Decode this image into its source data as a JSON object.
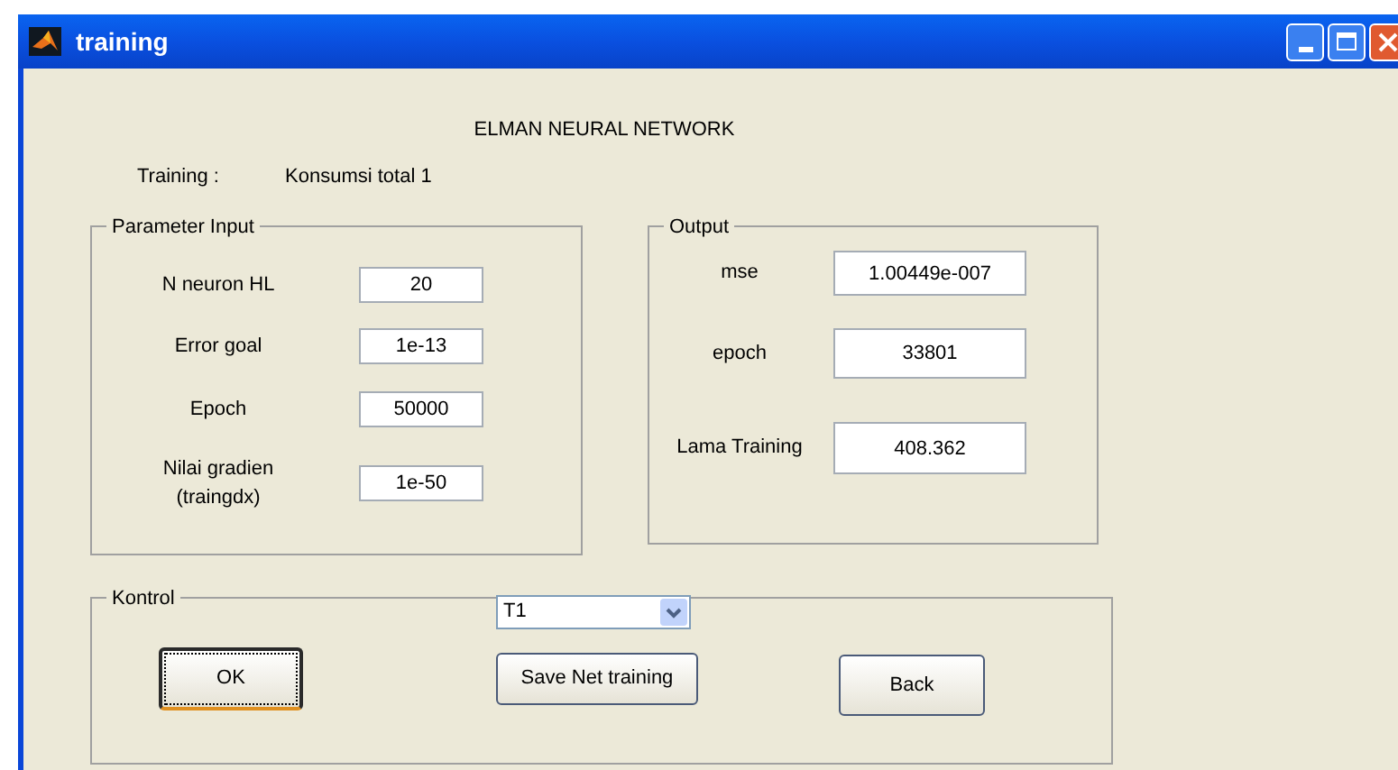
{
  "window": {
    "title": "training"
  },
  "heading": "ELMAN NEURAL NETWORK",
  "training": {
    "label": "Training :",
    "value": "Konsumsi total 1"
  },
  "parameter_input": {
    "title": "Parameter Input",
    "fields": [
      {
        "label": "N neuron HL",
        "value": "20"
      },
      {
        "label": "Error goal",
        "value": "1e-13"
      },
      {
        "label": "Epoch",
        "value": "50000"
      },
      {
        "label": "Nilai gradien\n(traingdx)",
        "value": "1e-50"
      }
    ]
  },
  "output": {
    "title": "Output",
    "fields": [
      {
        "label": "mse",
        "value": "1.00449e-007"
      },
      {
        "label": "epoch",
        "value": "33801"
      },
      {
        "label": "Lama Training",
        "value": "408.362"
      }
    ]
  },
  "kontrol": {
    "title": "Kontrol",
    "dropdown": {
      "value": "T1"
    },
    "buttons": [
      {
        "label": "OK",
        "focused": true
      },
      {
        "label": "Save Net training",
        "focused": false
      },
      {
        "label": "Back",
        "focused": false
      }
    ]
  }
}
